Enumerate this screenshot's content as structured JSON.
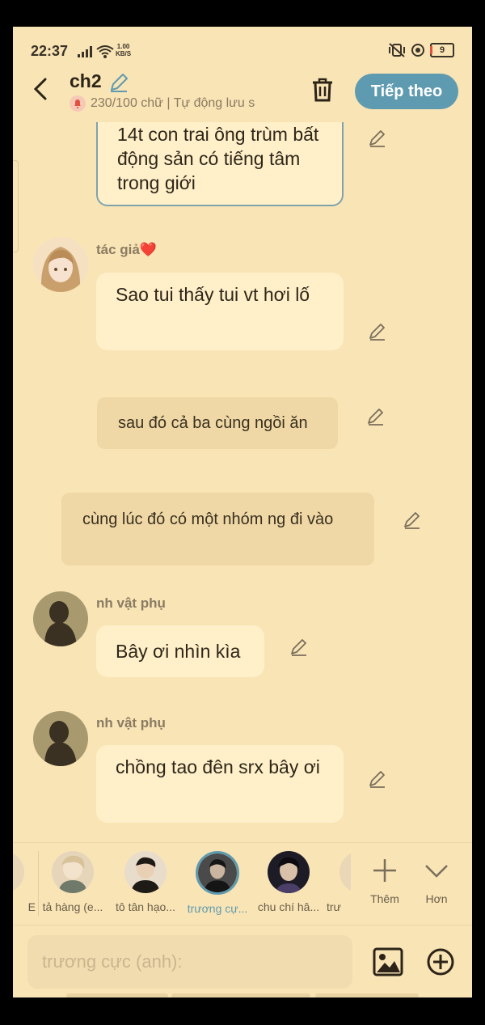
{
  "status": {
    "time": "22:37",
    "speed_value": "1.00",
    "speed_unit": "KB/S",
    "battery": "9"
  },
  "header": {
    "title": "ch2",
    "word_count": "230/100 chữ | Tự động lưu s",
    "next_label": "Tiếp theo"
  },
  "messages": [
    {
      "text": "14t con trai ông trùm bất động sản có tiếng tâm trong giới"
    },
    {
      "speaker": "tác giả❤️",
      "text": "Sao tui thấy tui vt hơi lố"
    },
    {
      "text": "sau đó cả ba cùng ngồi ăn"
    },
    {
      "text": "cùng lúc đó có một nhóm ng đi vào"
    },
    {
      "speaker": "nh vật phụ",
      "text": "Bây ơi nhìn kìa"
    },
    {
      "speaker": "nh vật phụ",
      "text": "chồng tao đên srx bây ơi"
    }
  ],
  "characters": [
    {
      "label": "E"
    },
    {
      "label": "tả hàng (e..."
    },
    {
      "label": "tô tân hạo..."
    },
    {
      "label": "trương cự..."
    },
    {
      "label": "chu chí hâ..."
    },
    {
      "label": "trư"
    }
  ],
  "tools": {
    "add_label": "Thêm",
    "more_label": "Hơn"
  },
  "composer": {
    "placeholder": "trương cực (anh):"
  },
  "colors": {
    "background": "#f9e4b5",
    "accent": "#5f9bb0",
    "bubble": "#fff0c9",
    "narration": "#efd8a6"
  }
}
